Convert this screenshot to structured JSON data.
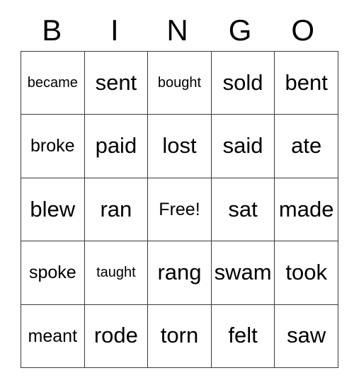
{
  "card": {
    "title": "BINGO",
    "headers": [
      "B",
      "I",
      "N",
      "G",
      "O"
    ],
    "free_space_label": "Free!",
    "free_space_position": {
      "row": 2,
      "col": 2
    },
    "rows": [
      [
        "became",
        "sent",
        "bought",
        "sold",
        "bent"
      ],
      [
        "broke",
        "paid",
        "lost",
        "said",
        "ate"
      ],
      [
        "blew",
        "ran",
        "Free!",
        "sat",
        "made"
      ],
      [
        "spoke",
        "taught",
        "rang",
        "swam",
        "took"
      ],
      [
        "meant",
        "rode",
        "torn",
        "felt",
        "saw"
      ]
    ]
  },
  "style": {
    "background_color": "#ffffff",
    "text_color": "#000000",
    "border_color": "#3a3a3a"
  }
}
